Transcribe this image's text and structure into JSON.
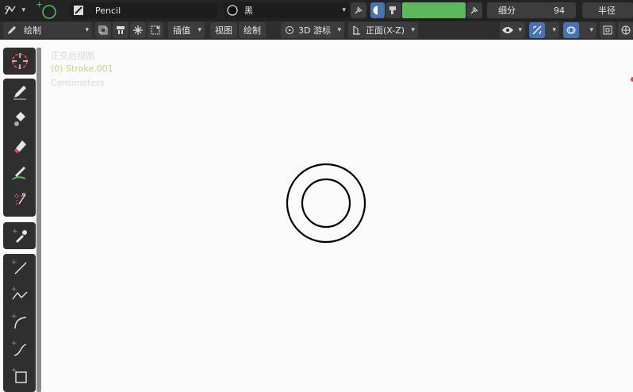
{
  "topbar": {
    "brush_name": "Pencil",
    "material_name": "黑",
    "subdivision_label": "细分",
    "subdivision_value": "94",
    "radius_label": "半径",
    "vertex_color": "#5cb85c"
  },
  "secondbar": {
    "mode_label": "绘制",
    "interpolate_label": "插值",
    "view_label": "视图",
    "draw_label": "绘制",
    "cursor_label": "3D 游标",
    "plane_label": "正面(X-Z)"
  },
  "overlay": {
    "view_name": "正交后视图",
    "object_name": "(0) Stroke.001",
    "units": "Centimeters"
  },
  "colors": {
    "header_bg": "#232323",
    "toolbar_bg": "#2e2e2e",
    "viewport_bg": "#fafafa",
    "accent_blue": "#4772b3",
    "green_accent": "#5cb85c",
    "stroke": "#000000"
  },
  "icons": {
    "editor_type": "editor-type-icon",
    "brush": "pencil-icon",
    "fill": "fill-bucket-icon",
    "erase": "eraser-icon",
    "tint": "tint-brush-icon",
    "cutter": "scissors-icon",
    "eyedropper": "eyedropper-icon",
    "line": "line-icon",
    "polyline": "polyline-icon",
    "arc": "arc-icon",
    "curve": "curve-icon",
    "box": "box-icon"
  }
}
